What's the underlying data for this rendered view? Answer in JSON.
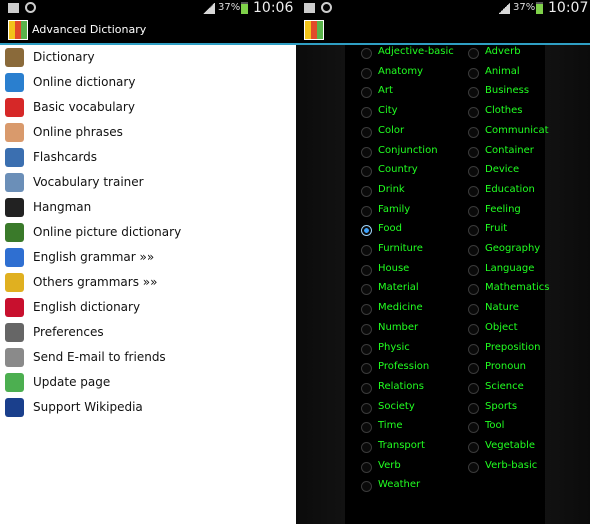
{
  "left": {
    "status": {
      "battery": "37%",
      "time": "10:06"
    },
    "app_title": "Advanced Dictionary",
    "menu_items": [
      {
        "label": "Dictionary",
        "icon": "books-icon",
        "color": "#8a6a3a"
      },
      {
        "label": "Online dictionary",
        "icon": "globe-icon",
        "color": "#2a7fcf"
      },
      {
        "label": "Basic vocabulary",
        "icon": "red-book-icon",
        "color": "#d62828"
      },
      {
        "label": "Online phrases",
        "icon": "person-icon",
        "color": "#d99a6c"
      },
      {
        "label": "Flashcards",
        "icon": "cards-icon",
        "color": "#3b6fb0"
      },
      {
        "label": "Vocabulary trainer",
        "icon": "checklist-icon",
        "color": "#6b8fb8"
      },
      {
        "label": "Hangman",
        "icon": "hangman-icon",
        "color": "#222222"
      },
      {
        "label": "Online picture dictionary",
        "icon": "picture-frame-icon",
        "color": "#3a7a2a"
      },
      {
        "label": "English grammar »»",
        "icon": "blocks-icon",
        "color": "#2f6fd1"
      },
      {
        "label": "Others grammars »»",
        "icon": "blocks-icon",
        "color": "#e0b020"
      },
      {
        "label": "English dictionary",
        "icon": "uk-flag-icon",
        "color": "#c8102e"
      },
      {
        "label": "Preferences",
        "icon": "hammer-icon",
        "color": "#666666"
      },
      {
        "label": "Send E-mail to friends",
        "icon": "envelope-icon",
        "color": "#8a8a8a"
      },
      {
        "label": "Update page",
        "icon": "download-icon",
        "color": "#4caf50"
      },
      {
        "label": "Support Wikipedia",
        "icon": "visa-icon",
        "color": "#1a3f8c"
      }
    ]
  },
  "right": {
    "status": {
      "battery": "37%",
      "time": "10:07"
    },
    "categories_col1": [
      "Adjective-basic",
      "Anatomy",
      "Art",
      "City",
      "Color",
      "Conjunction",
      "Country",
      "Drink",
      "Family",
      "Food",
      "Furniture",
      "House",
      "Material",
      "Medicine",
      "Number",
      "Physic",
      "Profession",
      "Relations",
      "Society",
      "Time",
      "Transport",
      "Verb",
      "Weather"
    ],
    "categories_col2": [
      "Adverb",
      "Animal",
      "Business",
      "Clothes",
      "Communicat",
      "Container",
      "Device",
      "Education",
      "Feeling",
      "Fruit",
      "Geography",
      "Language",
      "Mathematics",
      "Nature",
      "Object",
      "Preposition",
      "Pronoun",
      "Science",
      "Sports",
      "Tool",
      "Vegetable",
      "Verb-basic"
    ],
    "selected": "Food"
  },
  "colors": {
    "accent": "#2f9fc4",
    "category_text": "#21ff21"
  }
}
